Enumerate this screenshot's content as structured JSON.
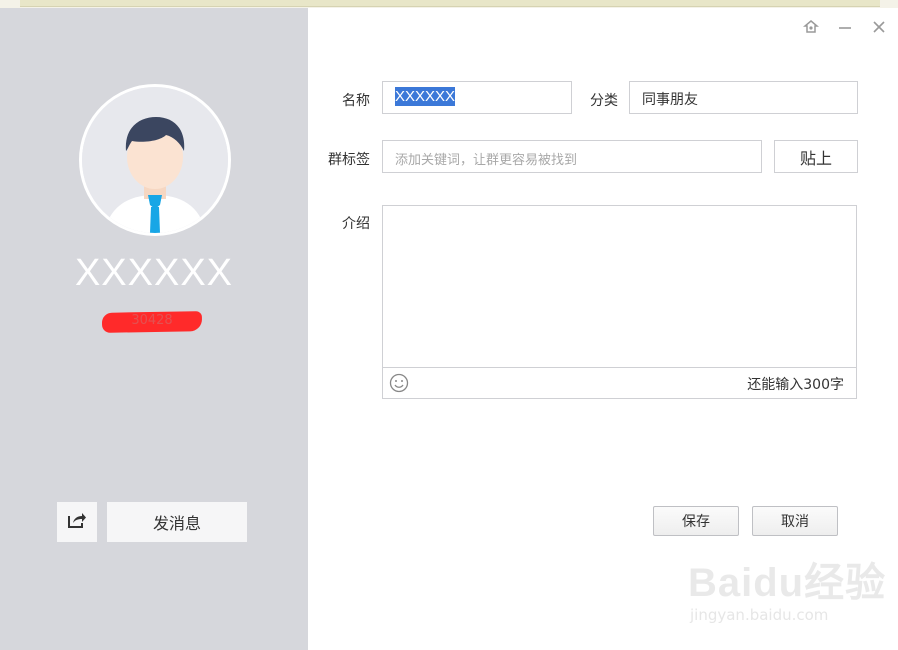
{
  "window": {
    "controls": [
      "pin-icon",
      "minimize-icon",
      "close-icon"
    ]
  },
  "profile": {
    "name": "XXXXXX",
    "id_redacted": "30428",
    "share_icon": "share-icon",
    "send_message_label": "发消息"
  },
  "form": {
    "name_label": "名称",
    "name_value": "XXXXXX",
    "category_label": "分类",
    "category_value": "同事朋友",
    "tags_label": "群标签",
    "tags_placeholder": "添加关键词，让群更容易被找到",
    "tag_button_label": "贴上",
    "intro_label": "介绍",
    "intro_value": "",
    "emoji_icon": "emoji-icon",
    "char_count": "还能输入300字"
  },
  "actions": {
    "save_label": "保存",
    "cancel_label": "取消"
  },
  "watermark": {
    "brand": "Baidu经验",
    "url": "jingyan.baidu.com"
  },
  "colors": {
    "sidebar_bg": "#d6d7dc",
    "selection": "#3b78d8",
    "redaction": "#ff2a2a"
  }
}
